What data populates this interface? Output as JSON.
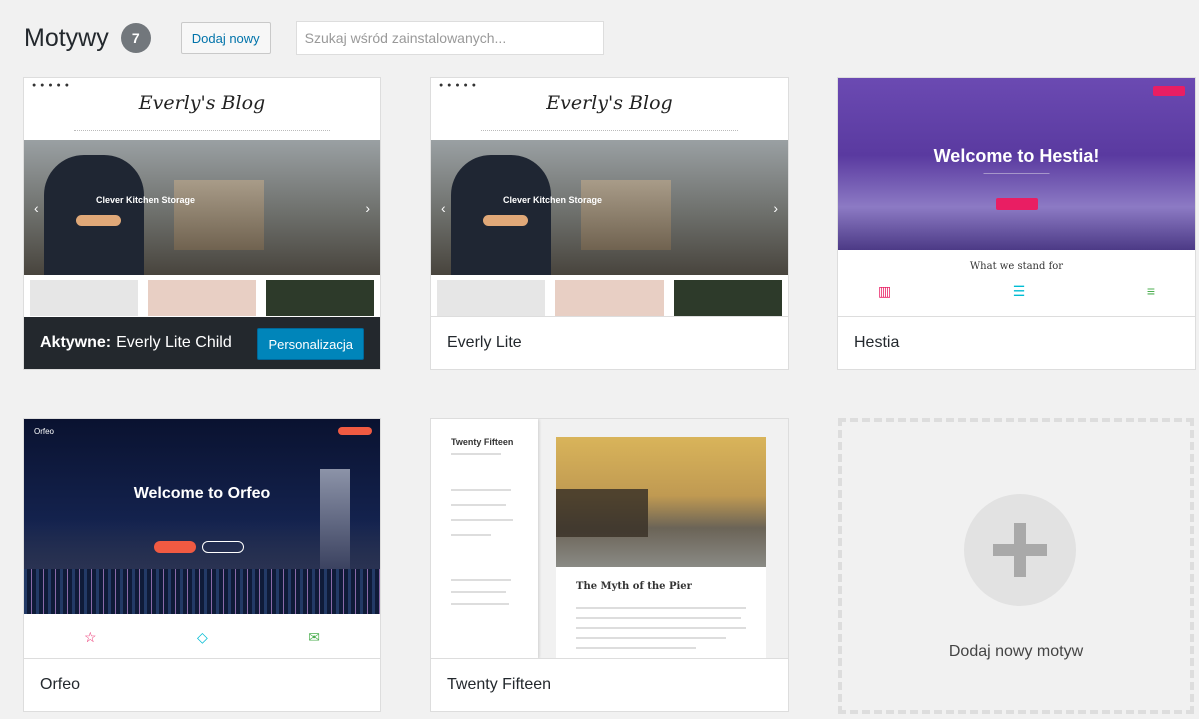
{
  "header": {
    "title": "Motywy",
    "count": "7",
    "add_new_label": "Dodaj nowy",
    "search_placeholder": "Szukaj wśród zainstalowanych..."
  },
  "themes": [
    {
      "name": "Everly Lite Child",
      "active_prefix": "Aktywne:",
      "customize_label": "Personalizacja",
      "preview": {
        "logo": "Everly's Blog",
        "hero_caption": "Clever Kitchen Storage"
      }
    },
    {
      "name": "Everly Lite",
      "preview": {
        "logo": "Everly's Blog",
        "hero_caption": "Clever Kitchen Storage"
      }
    },
    {
      "name": "Hestia",
      "preview": {
        "hero_title": "Welcome to Hestia!",
        "section_title": "What we stand for"
      }
    },
    {
      "name": "Orfeo",
      "preview": {
        "hero_title": "Welcome to Orfeo",
        "logo": "Orfeo"
      }
    },
    {
      "name": "Twenty Fifteen",
      "preview": {
        "site_title": "Twenty Fifteen",
        "post_title": "The Myth of the Pier"
      }
    }
  ],
  "add_new_theme": {
    "label": "Dodaj nowy motyw"
  },
  "colors": {
    "accent_blue": "#0085ba",
    "active_bar": "#23282d",
    "hestia_pink": "#e91e63",
    "orfeo_coral": "#f05a42"
  }
}
